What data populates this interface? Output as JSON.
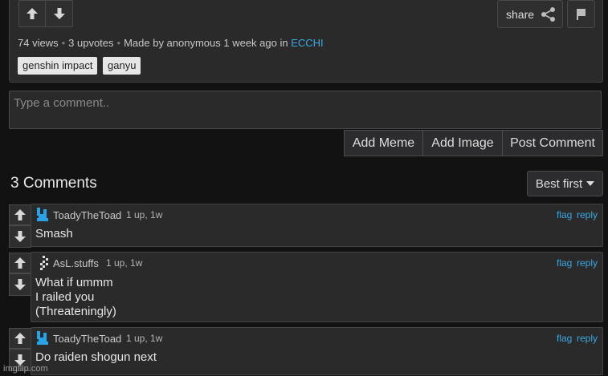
{
  "post": {
    "share_label": "share",
    "views": "74 views",
    "upvotes": "3 upvotes",
    "made_by": "Made by anonymous 1 week ago in",
    "stream": "ECCHI",
    "tags": [
      "genshin impact",
      "ganyu"
    ]
  },
  "comment_form": {
    "placeholder": "Type a comment..",
    "add_meme": "Add Meme",
    "add_image": "Add Image",
    "post_comment": "Post Comment"
  },
  "comments_header": {
    "count_label": "3 Comments",
    "sort_label": "Best first"
  },
  "comments": [
    {
      "user": "ToadyTheToad",
      "meta": "1 up, 1w",
      "lines": [
        "Smash"
      ],
      "flag": "flag",
      "reply": "reply"
    },
    {
      "user": "AsL.stuffs",
      "meta": "1 up, 1w",
      "lines": [
        "What if ummm",
        "I railed you",
        "(Threateningly)"
      ],
      "flag": "flag",
      "reply": "reply"
    },
    {
      "user": "ToadyTheToad",
      "meta": "1 up, 1w",
      "lines": [
        "Do raiden shogun next"
      ],
      "flag": "flag",
      "reply": "reply"
    }
  ],
  "watermark": "imgflip.com",
  "colors": {
    "link": "#3aa8e0",
    "background": "#121213",
    "panel": "#2a2a2b"
  }
}
